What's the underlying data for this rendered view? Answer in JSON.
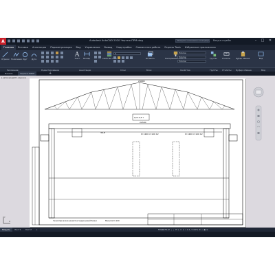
{
  "app": {
    "logo_letter": "A",
    "title": "Autodesk AutoCAD 2020   Чертеж-ПРМ.dwg",
    "search_placeholder": "Введите ключевое слово/фразу",
    "signin": "Вход в службы",
    "window_controls": [
      "–",
      "□",
      "✕"
    ]
  },
  "menu_tabs": [
    "Главная",
    "Вставка",
    "Аннотации",
    "Параметризация",
    "Вид",
    "Управление",
    "Вывод",
    "Надстройки",
    "Совместная работа",
    "Express Tools",
    "Избранные приложения"
  ],
  "active_tab": "Главная",
  "ribbon": {
    "draw": {
      "line": "Отрезок",
      "polyline": "Полилиния",
      "circle": "Круг",
      "arc": "Дуга"
    },
    "modify_label": "Редактирование",
    "annotation": {
      "text": "Текст",
      "dimension": "Размер"
    },
    "layers": {
      "props": "Свойства слоя",
      "current_layer": "0"
    },
    "insert": "Вставить",
    "properties": {
      "match": "Копирование свойств",
      "bylayer1": "ПоСлою",
      "bylayer2": "ПоСлою",
      "bylayer3": "ПоСлою"
    },
    "groups": "Группы",
    "utilities": "Утилиты",
    "clipboard": "Буфер обмена",
    "view": "Вид"
  },
  "ribbon_labels": {
    "draw": "Рисование",
    "modify": "Редактирование",
    "annotation": "Аннотации",
    "layers": "Слои",
    "block": "Блок",
    "properties": "Свойства",
    "groups": "Группы",
    "utilities": "Утилиты",
    "clipboard": "Буфер обмена",
    "view": "Вид"
  },
  "doc_tabs": [
    "Начало",
    "Чертеж-ПРМ*"
  ],
  "active_doc": "Чертеж-ПРМ*",
  "viewport_label": "[–][Сверху][2D-каркас]",
  "drawing": {
    "label_top": "24000",
    "label_crane": "Q=12,5 т",
    "label_span": "22500",
    "label_col1": "Ф 1200 Х 100 12",
    "label_col2": "Ф 1200 Х 100 12",
    "label_level": "36,8",
    "note": "Геометрическая разметка подкрановой балки",
    "sheet_no": "Масштаб 1:100"
  },
  "layout_tabs": [
    "Модель",
    "Лист1",
    "Лист2"
  ],
  "active_layout": "Модель",
  "status_right": "МОДЕЛЬ  # ⋮⋮  ⟳ ⊾ ▭ ∠ ⌖  1:1 / 100%  ⚙  +  ▣  ≡"
}
